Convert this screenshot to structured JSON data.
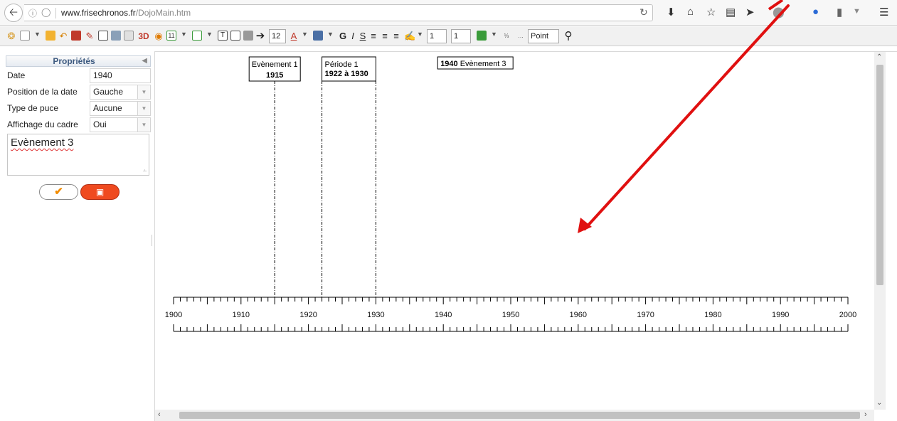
{
  "browser": {
    "url_host": "www.frisechronos.fr",
    "url_path": "/DojoMain.htm",
    "icons": [
      "back-icon",
      "info-icon",
      "shield-icon",
      "reload-icon",
      "download-icon",
      "home-icon",
      "bookmark-star-icon",
      "reading-list-icon",
      "send-icon",
      "adblock-icon",
      "extension-icon",
      "menu-icon"
    ]
  },
  "toolbar": {
    "text_3d": "3D",
    "calendar_label": "11",
    "font_size": "12",
    "font_color_letter": "A",
    "bold": "G",
    "italic": "I",
    "underline": "S",
    "textbox_glyph": "T",
    "line_width_1": "1",
    "line_width_2": "1",
    "unit_label": "Point",
    "colors": {
      "accent_orange": "#f28c00",
      "red": "#c0392b",
      "green": "#3a9b3a",
      "blue": "#1f4fbf"
    }
  },
  "properties": {
    "title": "Propriétés",
    "rows": [
      {
        "label": "Date",
        "value": "1940"
      },
      {
        "label": "Position de la date",
        "value": "Gauche"
      },
      {
        "label": "Type de puce",
        "value": "Aucune"
      },
      {
        "label": "Affichage du cadre",
        "value": "Oui"
      }
    ],
    "text_value": "Evènement 3",
    "ok_icon": "check-icon",
    "delete_icon": "trash-icon",
    "delete_color": "#ef4a1f"
  },
  "timeline": {
    "start_year": 1900,
    "end_year": 2000,
    "label_step": 10,
    "events": [
      {
        "type": "event",
        "title": "Evènement 1",
        "date_label": "1915",
        "year": 1915
      },
      {
        "type": "period",
        "title": "Période 1",
        "date_label": "1922 à 1930",
        "start": 1922,
        "end": 1930
      },
      {
        "type": "event",
        "title": "Evènement 3",
        "date_label": "1940",
        "year": 1940,
        "date_position": "left"
      }
    ]
  },
  "annotation": {
    "color": "#e01010"
  }
}
